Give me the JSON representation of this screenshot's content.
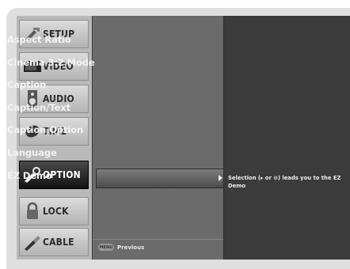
{
  "tabs": [
    {
      "label": "SETUP",
      "icon": "setup-icon",
      "active": false
    },
    {
      "label": "VIDEO",
      "icon": "video-icon",
      "active": false
    },
    {
      "label": "AUDIO",
      "icon": "audio-icon",
      "active": false
    },
    {
      "label": "TIME",
      "icon": "time-icon",
      "active": false
    },
    {
      "label": "OPTION",
      "icon": "option-icon",
      "active": true
    },
    {
      "label": "LOCK",
      "icon": "lock-icon",
      "active": false
    },
    {
      "label": "CABLE",
      "icon": "cable-icon",
      "active": false
    }
  ],
  "menu": {
    "items": [
      "Aspect Ratio",
      "Cinema 3:2 Mode",
      "Caption",
      "Caption/Text",
      "Caption Option",
      "Language",
      "EZ Demo"
    ],
    "selected": "EZ Demo"
  },
  "help": {
    "text": "Selection (▸ or ⊙) leads you to the EZ Demo"
  },
  "footer": {
    "key_label": "MENU",
    "text": "Previous"
  },
  "colors": {
    "screen": "#3b3b3b",
    "menu": "#6b6b6b",
    "active_tab": "#1a1a1a"
  }
}
